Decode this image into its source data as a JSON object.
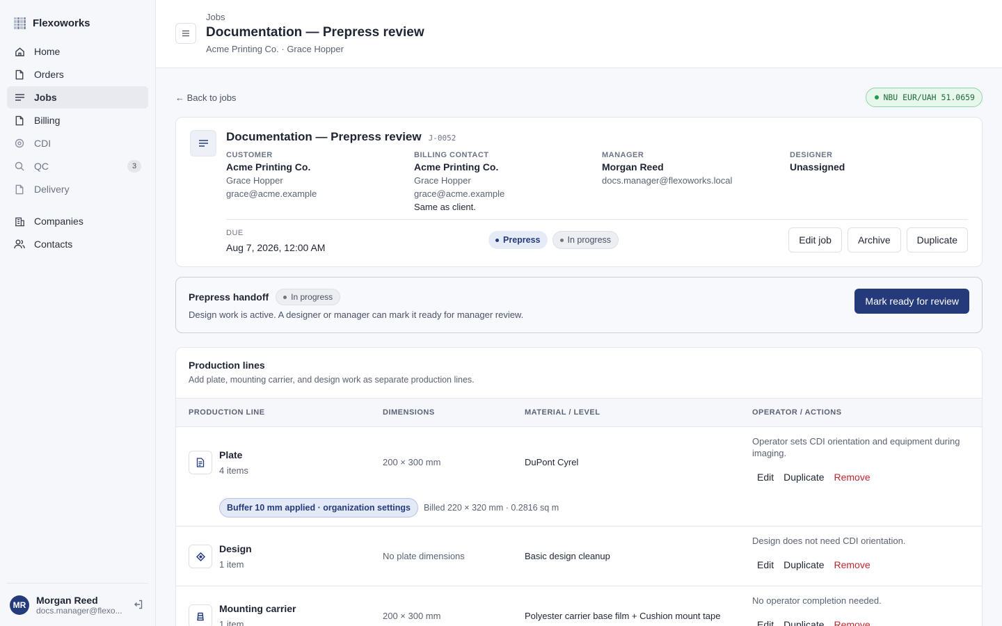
{
  "app": {
    "name": "Flexoworks"
  },
  "sidebar": {
    "items": [
      {
        "label": "Home",
        "icon": "home-icon"
      },
      {
        "label": "Orders",
        "icon": "file-icon"
      },
      {
        "label": "Jobs",
        "icon": "list-icon",
        "active": true
      },
      {
        "label": "Billing",
        "icon": "file-icon"
      },
      {
        "label": "CDI",
        "icon": "target-icon"
      },
      {
        "label": "QC",
        "icon": "search-icon",
        "badge": "3"
      },
      {
        "label": "Delivery",
        "icon": "file-icon"
      }
    ],
    "items2": [
      {
        "label": "Companies",
        "icon": "building-icon"
      },
      {
        "label": "Contacts",
        "icon": "users-icon"
      }
    ],
    "user": {
      "initials": "MR",
      "name": "Morgan Reed",
      "email": "docs.manager@flexo..."
    }
  },
  "header": {
    "breadcrumb": "Jobs",
    "title": "Documentation — Prepress review",
    "subtitle": "Acme Printing Co. · Grace Hopper"
  },
  "back_link": "← Back to jobs",
  "rate": "NBU EUR/UAH 51.0659",
  "job": {
    "title": "Documentation — Prepress review",
    "code": "J-0052",
    "customer": {
      "label": "CUSTOMER",
      "company": "Acme Printing Co.",
      "person": "Grace Hopper",
      "email": "grace@acme.example"
    },
    "billing": {
      "label": "BILLING CONTACT",
      "company": "Acme Printing Co.",
      "person": "Grace Hopper",
      "email": "grace@acme.example",
      "note": "Same as client."
    },
    "manager": {
      "label": "MANAGER",
      "name": "Morgan Reed",
      "email": "docs.manager@flexoworks.local"
    },
    "designer": {
      "label": "DESIGNER",
      "name": "Unassigned"
    },
    "due_label": "DUE",
    "due_value": "Aug 7, 2026, 12:00 AM",
    "stage_chip": "Prepress",
    "status_chip": "In progress",
    "actions": {
      "edit": "Edit job",
      "archive": "Archive",
      "duplicate": "Duplicate"
    }
  },
  "handoff": {
    "title": "Prepress handoff",
    "status": "In progress",
    "description": "Design work is active. A designer or manager can mark it ready for manager review.",
    "button": "Mark ready for review"
  },
  "production": {
    "title": "Production lines",
    "subtitle": "Add plate, mounting carrier, and design work as separate production lines.",
    "columns": [
      "PRODUCTION LINE",
      "DIMENSIONS",
      "MATERIAL / LEVEL",
      "OPERATOR / ACTIONS"
    ],
    "rows": [
      {
        "name": "Plate",
        "count": "4 items",
        "dimensions": "200 × 300 mm",
        "material": "DuPont Cyrel",
        "note": "Operator sets CDI orientation and equipment during imaging.",
        "buffer": "Buffer 10 mm applied · organization settings",
        "billed": "Billed 220 × 320 mm · 0.2816 sq m"
      },
      {
        "name": "Design",
        "count": "1 item",
        "dimensions": "No plate dimensions",
        "material": "Basic design cleanup",
        "note": "Design does not need CDI orientation."
      },
      {
        "name": "Mounting carrier",
        "count": "1 item",
        "dimensions": "200 × 300 mm",
        "material": "Polyester carrier base film + Cushion mount tape",
        "note": "No operator completion needed."
      }
    ],
    "row_actions": {
      "edit": "Edit",
      "duplicate": "Duplicate",
      "remove": "Remove"
    }
  },
  "colors": {
    "accent": "#243a7a",
    "danger": "#c0262d",
    "success": "#1f9a4b"
  }
}
